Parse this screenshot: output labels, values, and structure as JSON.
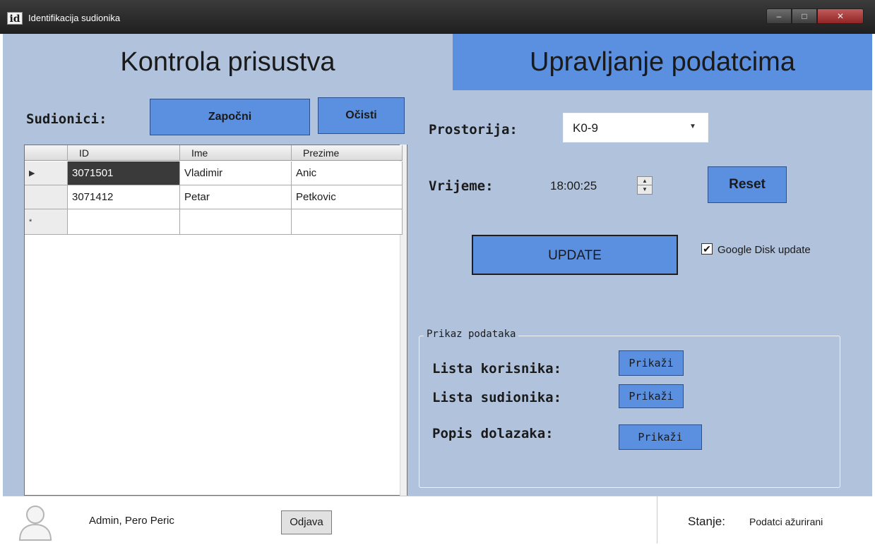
{
  "window": {
    "title": "Identifikacija sudionika",
    "icon_text": "id",
    "minimize_glyph": "–",
    "maximize_glyph": "□",
    "close_glyph": "✕"
  },
  "headers": {
    "left": "Kontrola prisustva",
    "right": "Upravljanje podatcima"
  },
  "attendance": {
    "label": "Sudionici:",
    "start_button": "Započni",
    "clear_button": "Očisti",
    "grid": {
      "columns": [
        "ID",
        "Ime",
        "Prezime"
      ],
      "row_markers": [
        "▶",
        "",
        "*"
      ],
      "rows": [
        [
          "3071501",
          "Vladimir",
          "Anic"
        ],
        [
          "3071412",
          "Petar",
          "Petkovic"
        ],
        [
          "",
          "",
          ""
        ]
      ]
    }
  },
  "data_management": {
    "room_label": "Prostorija:",
    "room_value": "K0-9",
    "time_label": "Vrijeme:",
    "time_value": "18:00:25",
    "reset_button": "Reset",
    "update_button": "UPDATE",
    "google_disk": {
      "checked": true,
      "check_glyph": "✔",
      "label": "Google Disk update"
    },
    "group": {
      "title": "Prikaz podataka",
      "items": [
        {
          "label": "Lista korisnika:",
          "button": "Prikaži"
        },
        {
          "label": "Lista sudionika:",
          "button": "Prikaži"
        },
        {
          "label": "Popis dolazaka:",
          "button": "Prikaži"
        }
      ]
    }
  },
  "status_bar": {
    "user": "Admin, Pero Peric",
    "logout_button": "Odjava",
    "state_label": "Stanje:",
    "state_value": "Podatci ažurirani"
  },
  "colors": {
    "client_bg": "#b1c3dc",
    "accent_blue": "#5b8fe0",
    "selected_cell": "#3a3a3a"
  }
}
